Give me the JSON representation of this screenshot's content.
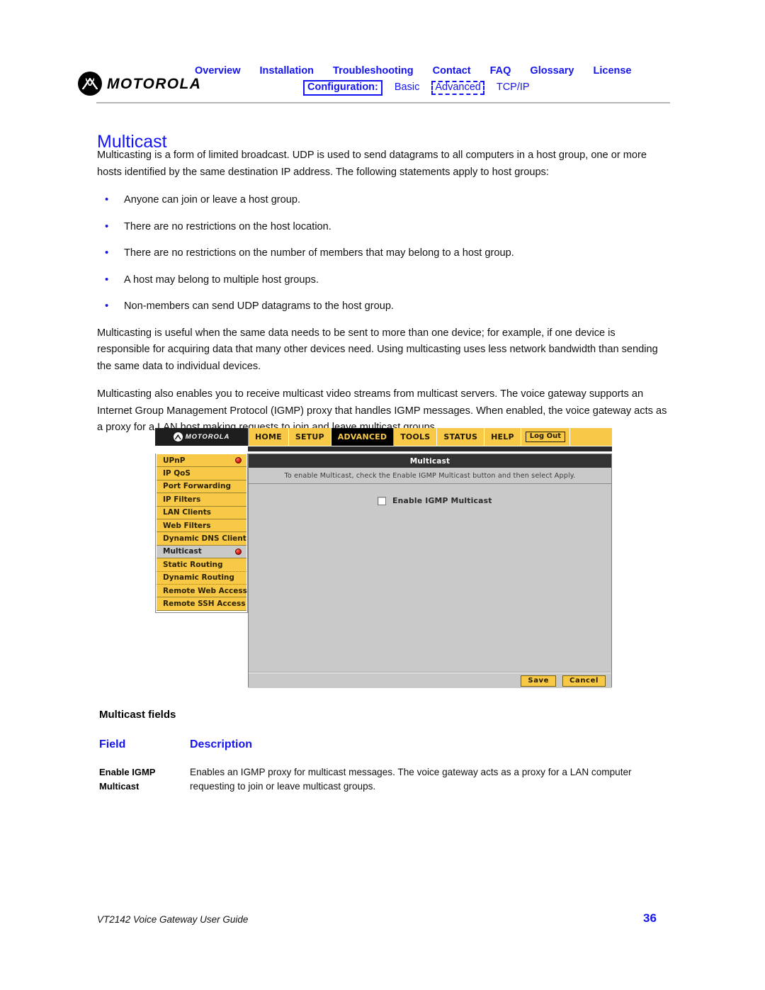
{
  "brand": {
    "name": "MOTOROLA",
    "logo_icon": "motorola-batwing-icon"
  },
  "header": {
    "primary_nav": [
      "Overview",
      "Installation",
      "Troubleshooting",
      "Contact",
      "FAQ",
      "Glossary",
      "License"
    ],
    "secondary_nav": {
      "label": "Configuration:",
      "items": [
        "Basic",
        "Advanced",
        "TCP/IP"
      ],
      "selected": "Advanced"
    }
  },
  "page": {
    "title": "Multicast",
    "intro": "Multicasting is a form of limited broadcast. UDP is used to send datagrams to all computers in a host group, one or more hosts identified by the same destination IP address. The following statements apply to host groups:",
    "bullets": [
      "Anyone can join or leave a host group.",
      "There are no restrictions on the host location.",
      "There are no restrictions on the number of members that may belong to a host group.",
      "A host may belong to multiple host groups.",
      "Non-members can send UDP datagrams to the host group."
    ],
    "paragraph2": "Multicasting is useful when the same data needs to be sent to more than one device; for example, if one device is responsible for acquiring data that many other devices need. Using multicasting uses less network bandwidth than sending the same data to individual devices.",
    "paragraph3": "Multicasting also enables you to receive multicast video streams from multicast servers. The voice gateway supports an Internet Group Management Protocol (IGMP) proxy that handles IGMP messages. When enabled, the voice gateway acts as a proxy for a LAN host making requests to join and leave multicast groups."
  },
  "router_ui": {
    "brand": "MOTOROLA",
    "top_menu": [
      {
        "label": "HOME",
        "active": false
      },
      {
        "label": "SETUP",
        "active": false
      },
      {
        "label": "ADVANCED",
        "active": true
      },
      {
        "label": "TOOLS",
        "active": false
      },
      {
        "label": "STATUS",
        "active": false
      },
      {
        "label": "HELP",
        "active": false
      }
    ],
    "logout_label": "Log Out",
    "sidebar": [
      {
        "label": "UPnP",
        "selected": false,
        "dot": true
      },
      {
        "label": "IP QoS",
        "selected": false,
        "dot": false
      },
      {
        "label": "Port Forwarding",
        "selected": false,
        "dot": false
      },
      {
        "label": "IP Filters",
        "selected": false,
        "dot": false
      },
      {
        "label": "LAN Clients",
        "selected": false,
        "dot": false
      },
      {
        "label": "Web Filters",
        "selected": false,
        "dot": false
      },
      {
        "label": "Dynamic DNS Client",
        "selected": false,
        "dot": false
      },
      {
        "label": "Multicast",
        "selected": true,
        "dot": true
      },
      {
        "label": "Static Routing",
        "selected": false,
        "dot": false
      },
      {
        "label": "Dynamic Routing",
        "selected": false,
        "dot": false
      },
      {
        "label": "Remote Web Access",
        "selected": false,
        "dot": false
      },
      {
        "label": "Remote SSH Access",
        "selected": false,
        "dot": false
      }
    ],
    "panel_title": "Multicast",
    "panel_description": "To enable Multicast, check the Enable IGMP Multicast button and then select Apply.",
    "checkbox_label": "Enable IGMP Multicast",
    "checkbox_checked": false,
    "buttons": {
      "save": "Save",
      "cancel": "Cancel"
    }
  },
  "fields_table": {
    "caption": "Multicast fields",
    "headers": {
      "field": "Field",
      "description": "Description"
    },
    "rows": [
      {
        "field_line1": "Enable IGMP",
        "field_line2": "Multicast",
        "description": "Enables an IGMP proxy for multicast messages. The voice gateway acts as a proxy for a LAN computer requesting to join or leave multicast groups."
      }
    ]
  },
  "footer": {
    "document": "VT2142 Voice Gateway User Guide",
    "page_number": "36"
  },
  "colors": {
    "accent_blue": "#1414f0",
    "router_yellow": "#f7c947",
    "router_dark": "#1e1e1e",
    "panel_gray": "#c9c9c9"
  }
}
